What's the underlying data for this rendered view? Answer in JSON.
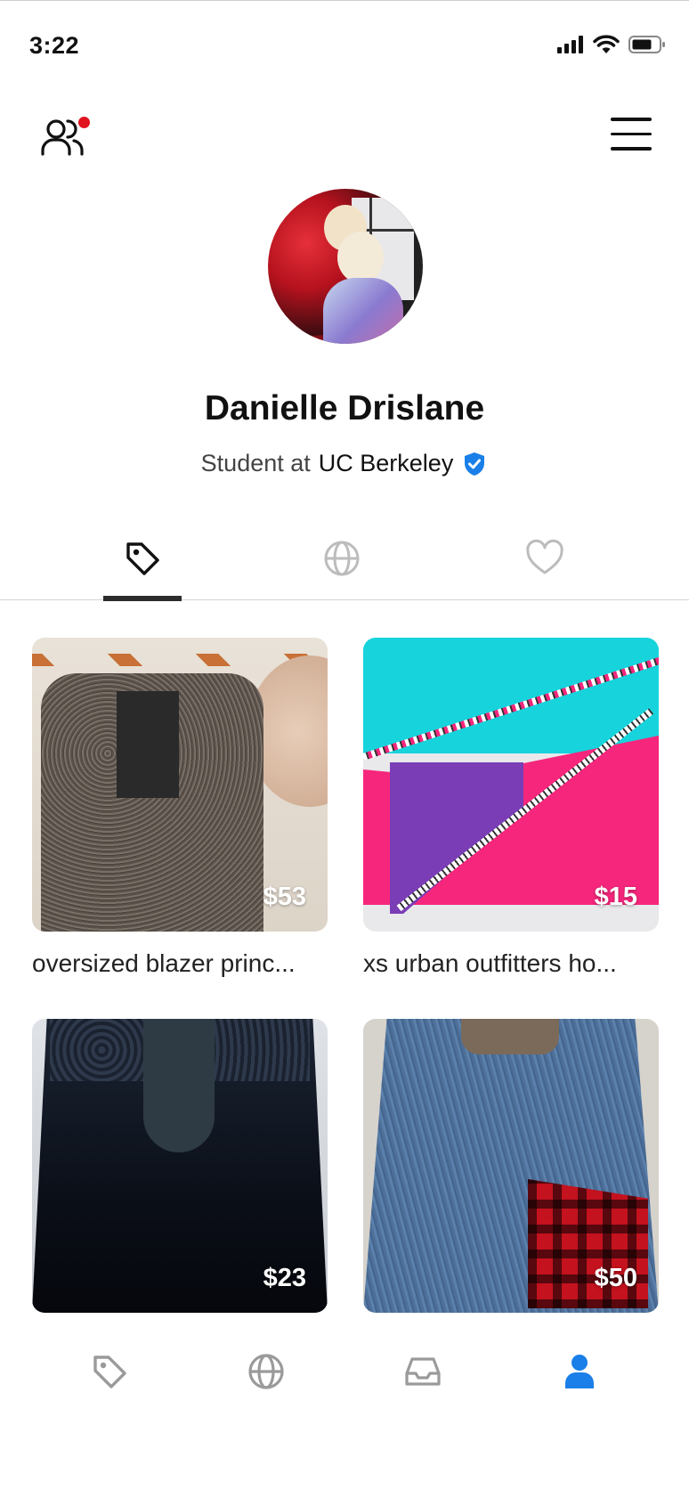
{
  "status_bar": {
    "time": "3:22"
  },
  "header": {
    "friends_icon": "people-icon",
    "menu_icon": "hamburger-menu-icon",
    "has_notification": true
  },
  "profile": {
    "name": "Danielle Drislane",
    "subtitle_prefix": "Student at",
    "school": "UC Berkeley",
    "verified": true,
    "avatar_alt": "Profile photo"
  },
  "tabs": [
    {
      "name": "listings",
      "icon": "tag-icon",
      "active": true
    },
    {
      "name": "explore",
      "icon": "globe-icon",
      "active": false
    },
    {
      "name": "favorites",
      "icon": "heart-icon",
      "active": false
    }
  ],
  "listings": [
    {
      "title": "oversized blazer princ...",
      "price": "$53"
    },
    {
      "title": "xs urban outfitters ho...",
      "price": "$15"
    },
    {
      "title": "",
      "price": "$23"
    },
    {
      "title": "",
      "price": "$50"
    }
  ],
  "bottom_nav": [
    {
      "name": "shop",
      "icon": "tag-icon",
      "active": false
    },
    {
      "name": "explore",
      "icon": "globe-icon",
      "active": false
    },
    {
      "name": "inbox",
      "icon": "inbox-icon",
      "active": false
    },
    {
      "name": "profile",
      "icon": "person-icon",
      "active": true
    }
  ],
  "colors": {
    "accent": "#1a7fe8",
    "notification": "#e0141e",
    "inactive_icon": "#9a9a9a"
  }
}
